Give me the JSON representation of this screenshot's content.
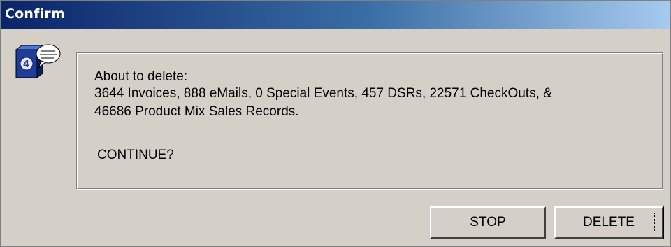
{
  "window": {
    "title": "Confirm"
  },
  "icon": {
    "name": "4d-app-speech-bubble-icon"
  },
  "message": {
    "line1": "About to delete:",
    "line2": "3644 Invoices, 888 eMails, 0 Special Events, 457 DSRs, 22571 CheckOuts, &",
    "line3": "46686 Product Mix Sales Records.",
    "prompt": "CONTINUE?"
  },
  "buttons": {
    "stop_label": "STOP",
    "delete_label": "DELETE"
  },
  "colors": {
    "dialog_face": "#d4d0c8",
    "titlebar_start": "#0a246a",
    "titlebar_end": "#a6caf0"
  }
}
